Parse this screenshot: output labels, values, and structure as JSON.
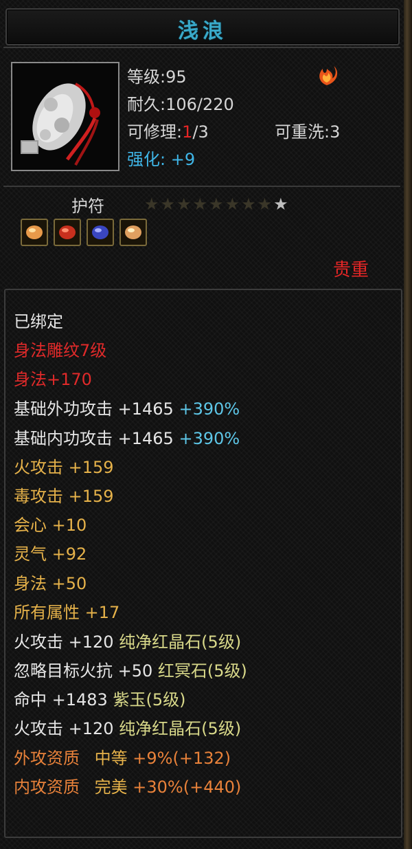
{
  "item": {
    "name": "浅浪",
    "level": "等级:95",
    "durability": "耐久:106/220",
    "repair_label": "可修理:",
    "repair_current": "1",
    "repair_total": "/3",
    "rewash": "可重洗:3",
    "enhance_label": "强化:",
    "enhance_value": "+9",
    "category": "护符",
    "stars_lit": 1,
    "stars_total": 9,
    "rarity": "贵重",
    "gems": [
      "orange-gem",
      "red-gem",
      "blue-gem",
      "orange-gem"
    ]
  },
  "colors": {
    "title": "#39a9c9",
    "red": "#e02a2a",
    "gold": "#e6b24a",
    "cyan": "#5ec7e8",
    "orange": "#e9823a"
  },
  "attributes": {
    "bound": "已绑定",
    "engraving": "身法雕纹7级",
    "engraving_bonus": "身法+170",
    "ext_attack": {
      "label": "基础外功攻击 +1465",
      "pct": "+390%"
    },
    "int_attack": {
      "label": "基础内功攻击 +1465",
      "pct": "+390%"
    },
    "fire_attack": "火攻击 +159",
    "poison_attack": "毒攻击 +159",
    "crit": "会心 +10",
    "spirit": "灵气 +92",
    "agility": "身法 +50",
    "all_attr": "所有属性 +17",
    "gem1": {
      "stat": "火攻击 +120",
      "name": "纯净红晶石(5级)"
    },
    "gem2": {
      "stat": "忽略目标火抗 +50",
      "name": "红冥石(5级)"
    },
    "gem3": {
      "stat": "命中 +1483",
      "name": "紫玉(5级)"
    },
    "gem4": {
      "stat": "火攻击 +120",
      "name": "纯净红晶石(5级)"
    },
    "ext_quality": {
      "label": "外攻资质",
      "grade": "中等",
      "value": "+9%(+132)"
    },
    "int_quality": {
      "label": "内攻资质",
      "grade": "完美",
      "value": "+30%(+440)"
    }
  }
}
